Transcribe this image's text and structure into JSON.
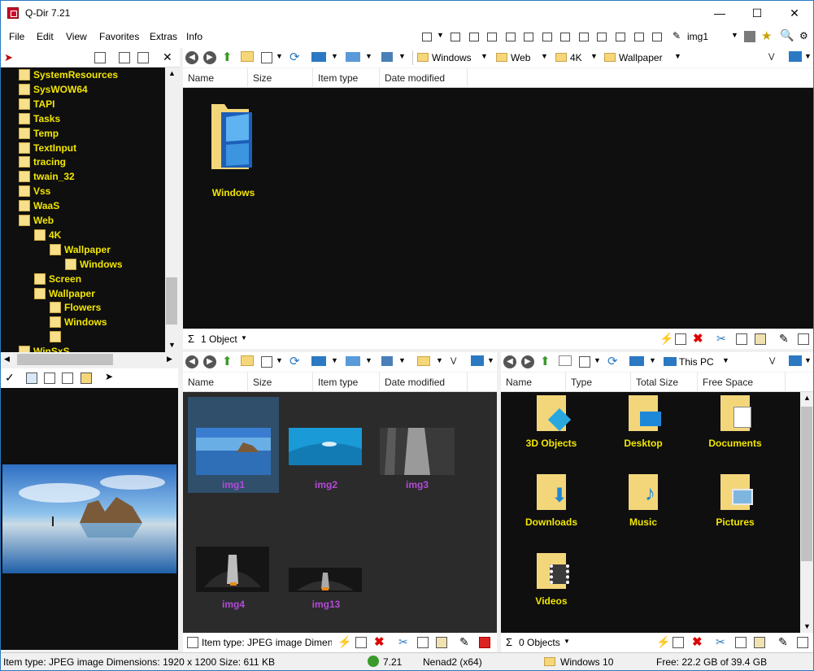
{
  "window": {
    "title": "Q-Dir 7.21"
  },
  "menu": [
    "File",
    "Edit",
    "View",
    "Favorites",
    "Extras",
    "Info"
  ],
  "toolbar": {
    "img_label": "img1"
  },
  "tree": {
    "items": [
      {
        "label": "SystemResources",
        "indent": 0
      },
      {
        "label": "SysWOW64",
        "indent": 0
      },
      {
        "label": "TAPI",
        "indent": 0
      },
      {
        "label": "Tasks",
        "indent": 0
      },
      {
        "label": "Temp",
        "indent": 0
      },
      {
        "label": "TextInput",
        "indent": 0
      },
      {
        "label": "tracing",
        "indent": 0
      },
      {
        "label": "twain_32",
        "indent": 0
      },
      {
        "label": "Vss",
        "indent": 0
      },
      {
        "label": "WaaS",
        "indent": 0
      },
      {
        "label": "Web",
        "indent": 0
      },
      {
        "label": "4K",
        "indent": 1
      },
      {
        "label": "Wallpaper",
        "indent": 2
      },
      {
        "label": "Windows",
        "indent": 3
      },
      {
        "label": "Screen",
        "indent": 1
      },
      {
        "label": "Wallpaper",
        "indent": 1
      },
      {
        "label": "Flowers",
        "indent": 2
      },
      {
        "label": "Windows",
        "indent": 2
      },
      {
        "label": "",
        "indent": 2
      },
      {
        "label": "WinSxS",
        "indent": 0
      }
    ]
  },
  "columns": {
    "name": "Name",
    "size": "Size",
    "item_type": "Item type",
    "date_modified": "Date modified",
    "type": "Type",
    "total_size": "Total Size",
    "free_space": "Free Space"
  },
  "pane1": {
    "breadcrumb": [
      "Windows",
      "Web",
      "4K",
      "Wallpaper"
    ],
    "items": [
      {
        "label": "Windows"
      }
    ],
    "status": "1 Object"
  },
  "pane2": {
    "items": [
      {
        "label": "img1"
      },
      {
        "label": "img2"
      },
      {
        "label": "img3"
      },
      {
        "label": "img4"
      },
      {
        "label": "img13"
      }
    ],
    "status": "Item type: JPEG image Dimens"
  },
  "pane3": {
    "location": "This PC",
    "items": [
      {
        "label": "3D Objects"
      },
      {
        "label": "Desktop"
      },
      {
        "label": "Documents"
      },
      {
        "label": "Downloads"
      },
      {
        "label": "Music"
      },
      {
        "label": "Pictures"
      },
      {
        "label": "Videos"
      }
    ],
    "status": "0 Objects"
  },
  "statusbar": {
    "info": "Item type: JPEG image Dimensions: 1920 x 1200 Size: 611 KB",
    "version": "7.21",
    "user": "Nenad2 (x64)",
    "os": "Windows 10",
    "free": "Free: 22.2 GB of 39.4 GB"
  },
  "colors": {
    "accent": "#2b79c2",
    "folder_label": "#f2e600",
    "image_label": "#b24bd6"
  },
  "icons": [
    "app-icon",
    "minimize-icon",
    "maximize-icon",
    "close-icon",
    "back-icon",
    "forward-icon",
    "up-icon",
    "new-folder-icon",
    "view-icon",
    "refresh-icon",
    "folder-icon",
    "monitor-icon",
    "cut-icon",
    "copy-icon",
    "paste-icon",
    "delete-icon",
    "sum-icon",
    "globe-icon"
  ]
}
